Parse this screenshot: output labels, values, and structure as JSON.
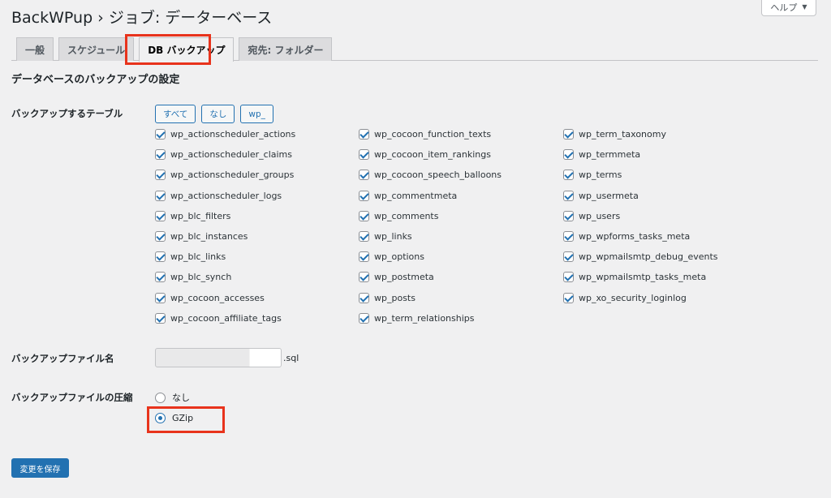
{
  "page": {
    "title": "BackWPup › ジョブ: データーベース",
    "help_label": "ヘルプ"
  },
  "tabs": [
    {
      "label": "一般"
    },
    {
      "label": "スケジュール"
    },
    {
      "label": "DB バックアップ"
    },
    {
      "label": "宛先: フォルダー"
    }
  ],
  "section_title": "データベースのバックアップの設定",
  "tables_field": {
    "label": "バックアップするテーブル",
    "buttons": {
      "all": "すべて",
      "none": "なし",
      "wp": "wp_"
    },
    "items": [
      "wp_actionscheduler_actions",
      "wp_actionscheduler_claims",
      "wp_actionscheduler_groups",
      "wp_actionscheduler_logs",
      "wp_blc_filters",
      "wp_blc_instances",
      "wp_blc_links",
      "wp_blc_synch",
      "wp_cocoon_accesses",
      "wp_cocoon_affiliate_tags",
      "wp_cocoon_function_texts",
      "wp_cocoon_item_rankings",
      "wp_cocoon_speech_balloons",
      "wp_commentmeta",
      "wp_comments",
      "wp_links",
      "wp_options",
      "wp_postmeta",
      "wp_posts",
      "wp_term_relationships",
      "wp_term_taxonomy",
      "wp_termmeta",
      "wp_terms",
      "wp_usermeta",
      "wp_users",
      "wp_wpforms_tasks_meta",
      "wp_wpmailsmtp_debug_events",
      "wp_wpmailsmtp_tasks_meta",
      "wp_xo_security_loginlog"
    ]
  },
  "filename_field": {
    "label": "バックアップファイル名",
    "value": "",
    "suffix": ".sql"
  },
  "compression_field": {
    "label": "バックアップファイルの圧縮",
    "option_none": "なし",
    "option_gzip": "GZip",
    "selected": "GZip"
  },
  "save_label": "変更を保存",
  "colors": {
    "accent": "#2271b1",
    "highlight": "#e8331c"
  }
}
